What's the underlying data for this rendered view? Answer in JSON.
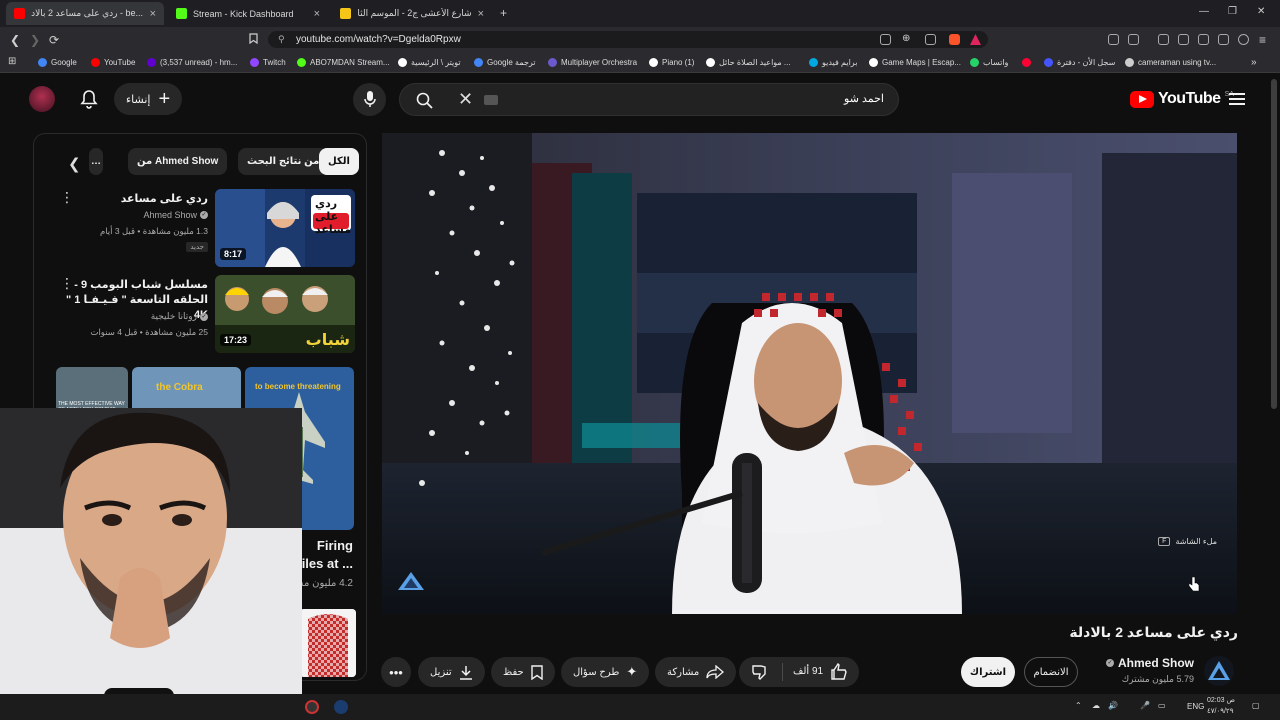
{
  "browser": {
    "tabs": [
      {
        "title": "...be - ردي على مساعد 2 بالادلة",
        "close": "×",
        "favicon_color": "#ff0000"
      },
      {
        "title": "Stream - Kick Dashboard",
        "close": "×",
        "favicon_color": "#53fc18"
      },
      {
        "title": "شارع الأعشى ج2 - الموسم الثاني - #29...",
        "close": "×",
        "favicon_color": "#f5c518"
      }
    ],
    "new_tab": "+",
    "window_controls": {
      "minimize": "—",
      "restore": "❐",
      "close": "✕"
    },
    "url": "youtube.com/watch?v=Dgelda0Rpxw",
    "bookmarks": [
      {
        "label": "Google",
        "color": "#4285f4"
      },
      {
        "label": "YouTube",
        "color": "#ff0000"
      },
      {
        "label": "(3,537 unread) - hm...",
        "color": "#6001d2"
      },
      {
        "label": "Twitch",
        "color": "#9146ff"
      },
      {
        "label": "ABO7MDAN Stream...",
        "color": "#53fc18"
      },
      {
        "label": "تويتر \\ الرئيسية",
        "color": "#ffffff"
      },
      {
        "label": "Google ترجمة",
        "color": "#4285f4"
      },
      {
        "label": "Multiplayer Orchestra",
        "color": "#6a5acd"
      },
      {
        "label": "Piano (1)",
        "color": "#ffffff"
      },
      {
        "label": "مواعيد الصلاة حائل ...",
        "color": "#ffffff"
      },
      {
        "label": "برايم فيديو",
        "color": "#00a8e1"
      },
      {
        "label": "Game Maps | Escap...",
        "color": "#ffffff"
      },
      {
        "label": "واتساب",
        "color": "#25d366"
      },
      {
        "label": "",
        "color": "#ff0033"
      },
      {
        "label": "سجل الأن - دفترة",
        "color": "#4455ff"
      },
      {
        "label": "cameraman using tv...",
        "color": "#cccccc"
      }
    ]
  },
  "header": {
    "logo_text": "YouTube",
    "region": "SA",
    "search_value": "احمد شو",
    "create_label": "إنشاء"
  },
  "sidebar": {
    "chips": [
      {
        "label": "الكل",
        "selected": true
      },
      {
        "label": "من نتائج البحث",
        "selected": false
      },
      {
        "label": "من Ahmed Show",
        "selected": false
      },
      {
        "label": "…",
        "selected": false
      }
    ],
    "recommendations": [
      {
        "title": "ردي على مساعد",
        "channel": "Ahmed Show",
        "verified": true,
        "meta": "1.3 مليون مشاهدة • قبل 3 أيام",
        "badge": "جديد",
        "duration": "8:17",
        "thumb_text": "ردي على مساعد"
      },
      {
        "title": "مسلسل شباب البومب 9 - الحلقه التاسعة \" فـيـفـا 1 \" 4K",
        "channel": "روتانا خليجية",
        "verified": true,
        "meta": "25 مليون مشاهدة • قبل 4 سنوات",
        "badge": "",
        "duration": "17:23",
        "thumb_text": "شباب البومب"
      }
    ],
    "shorts": [
      {
        "caption": "THE MOST EFFECTIVE WAY OF ARTILLERY COMBAT"
      },
      {
        "caption": "the Cobra"
      },
      {
        "caption": "to become threatening"
      }
    ],
    "short_title_line1": "Firing",
    "short_title_line2": "Missiles at ...",
    "short_views": "4.2 مليون مشاهدة"
  },
  "player": {
    "fullscreen_hint": "ملء الشاشة",
    "fullscreen_key": "F"
  },
  "video": {
    "title": "ردي على مساعد 2 بالادلة",
    "channel_name": "Ahmed Show",
    "subscribers": "5.79 مليون مشترك",
    "subscribe_label": "اشتراك",
    "join_label": "الانضمام",
    "like_count": "91 ألف",
    "share_label": "مشاركة",
    "ask_label": "طرح سؤال",
    "save_label": "حفظ",
    "download_label": "تنزيل"
  },
  "taskbar": {
    "language": "ENG",
    "time": "02:03 ص",
    "date": "٤٧/٠٩/٢٩"
  }
}
